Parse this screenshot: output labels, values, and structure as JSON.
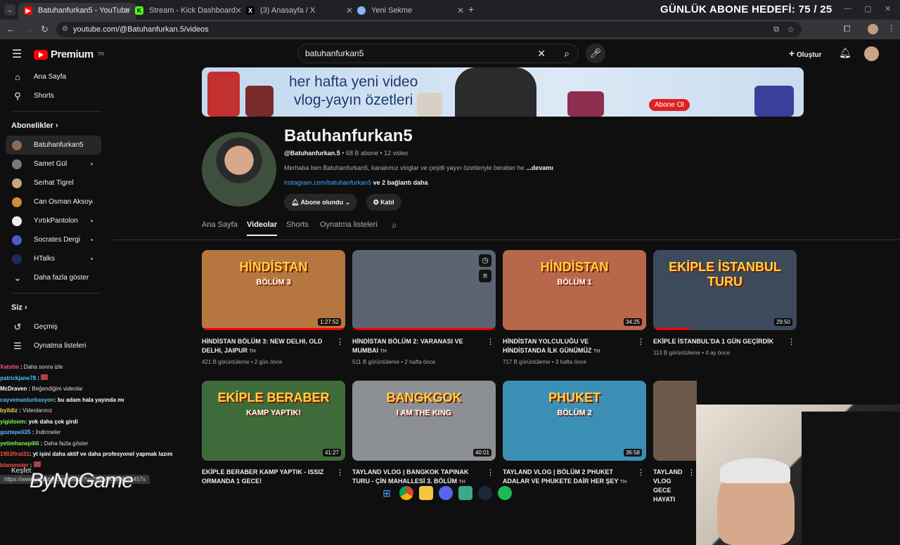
{
  "browser": {
    "tabs": [
      {
        "title": "Batuhanfurkan5 - YouTube",
        "favicon": "youtube-icon",
        "color": "#ff0000"
      },
      {
        "title": "Stream - Kick Dashboard",
        "favicon": "kick-icon",
        "color": "#53fc18"
      },
      {
        "title": "(3) Anasayfa / X",
        "favicon": "x-icon",
        "color": "#ffffff"
      },
      {
        "title": "Yeni Sekme",
        "favicon": "chrome-icon",
        "color": "#8ab4f8"
      }
    ],
    "url": "youtube.com/@Batuhanfurkan.5/videos",
    "status_url": "https://www.youtube.com/watch?v=25srtAXlSl8&t=1457s"
  },
  "overlay": {
    "goal": "GÜNLÜK ABONE HEDEFİ: 75 / 25",
    "watermark": "ByNoGame"
  },
  "youtube": {
    "logo_text": "Premium",
    "logo_region": "TR",
    "search_value": "batuhanfurkan5",
    "create_label": "Oluştur"
  },
  "sidebar": {
    "main": [
      {
        "label": "Ana Sayfa",
        "icon": "home-icon"
      },
      {
        "label": "Shorts",
        "icon": "shorts-icon"
      }
    ],
    "subs_title": "Abonelikler",
    "subs": [
      {
        "label": "Batuhanfurkan5",
        "dot": false
      },
      {
        "label": "Samet Gül",
        "dot": true
      },
      {
        "label": "Serhat Tigrel",
        "dot": false
      },
      {
        "label": "Can Osman Aksoy",
        "dot": true
      },
      {
        "label": "YırtıkPantolon",
        "dot": true
      },
      {
        "label": "Socrates Dergi",
        "dot": true
      },
      {
        "label": "HTalks",
        "dot": true
      }
    ],
    "show_more": "Daha fazla göster",
    "you_title": "Siz",
    "you": [
      {
        "label": "Geçmiş",
        "icon": "history-icon"
      },
      {
        "label": "Oynatma listeleri",
        "icon": "playlist-icon"
      },
      {
        "label": "Daha sonra izle",
        "icon": "clock-icon"
      },
      {
        "label": "Beğendiğim videolar",
        "icon": "like-icon"
      },
      {
        "label": "Videolarınız",
        "icon": "video-icon"
      },
      {
        "label": "İndirmeler",
        "icon": "download-icon"
      },
      {
        "label": "Daha fazla göster",
        "icon": "chevron-down-icon"
      },
      {
        "label": "Keşfet",
        "icon": "explore-icon"
      }
    ]
  },
  "banner": {
    "line1": "her hafta yeni video",
    "line2": "vlog-yayın özetleri",
    "subscribe": "Abone Ol"
  },
  "channel": {
    "name": "Batuhanfurkan5",
    "handle": "@Batuhanfurkan.5",
    "meta": " • 68 B abone • 12 video",
    "description": "Merhaba ben Batuhanfurkan5,  kanalımız vloglar ve çeşitli yayın özetleriyle beraber he",
    "more": "...devamı",
    "link": "instagram.com/batuhanfurkan5",
    "link_more": " ve 2 bağlantı daha",
    "subscribed_label": "Abone olundu",
    "join_label": "Katıl",
    "tabs": [
      "Ana Sayfa",
      "Videolar",
      "Shorts",
      "Oynatma listeleri"
    ]
  },
  "videos": [
    {
      "title": "HİNDİSTAN BÖLÜM 3: NEW DELHI, OLD DELHI, JAIPUR",
      "tag": "TH",
      "views": "421 B görüntüleme",
      "age": "2 gün önce",
      "duration": "1:27:52",
      "thumb_text": "HİNDİSTAN",
      "thumb_sub": "BÖLÜM 3",
      "thumb_bg": "#b5763f",
      "progress": 1.0
    },
    {
      "title": "HİNDİSTAN BÖLÜM 2: VARANASI VE MUMBAI",
      "tag": "TH",
      "views": "511 B görüntüleme",
      "age": "2 hafta önce",
      "duration": "",
      "thumb_text": "",
      "thumb_sub": "",
      "thumb_bg": "#5b6470",
      "progress": 1.0
    },
    {
      "title": "HİNDİSTAN YOLCULUĞU VE HİNDİSTANDA İLK GÜNÜMÜZ",
      "tag": "TH",
      "views": "717 B görüntüleme",
      "age": "3 hafta önce",
      "duration": "34:25",
      "thumb_text": "HİNDİSTAN",
      "thumb_sub": "BÖLÜM 1",
      "thumb_bg": "#b9674a",
      "progress": 0.0
    },
    {
      "title": "EKİPLE İSTANBUL'DA 1 GÜN GEÇİRDİK",
      "tag": "",
      "views": "113 B görüntüleme",
      "age": "4 ay önce",
      "duration": "29:50",
      "thumb_text": "EKİPLE İSTANBUL TURU",
      "thumb_sub": "",
      "thumb_bg": "#3d4a5c",
      "progress": 0.25
    },
    {
      "title": "EKİPLE BERABER KAMP YAPTIK - ISSIZ ORMANDA 1 GECE!",
      "tag": "",
      "views": "",
      "age": "",
      "duration": "41:27",
      "thumb_text": "EKİPLE BERABER",
      "thumb_sub": "KAMP YAPTIK!",
      "thumb_bg": "#3f6b3a",
      "progress": 0.0
    },
    {
      "title": "TAYLAND VLOG | BANGKOK TAPINAK TURU - ÇİN MAHALLESİ 3. BÖLÜM",
      "tag": "TH",
      "views": "",
      "age": "",
      "duration": "40:01",
      "thumb_text": "BANGKGOK",
      "thumb_sub": "I AM THE KING",
      "thumb_bg": "#8c8f93",
      "progress": 0.0
    },
    {
      "title": "TAYLAND VLOG | BÖLÜM 2 PHUKET ADALAR VE PHUKETE DAİR HER ŞEY",
      "tag": "TH",
      "views": "",
      "age": "",
      "duration": "36:58",
      "thumb_text": "PHUKET",
      "thumb_sub": "BÖLÜM 2",
      "thumb_bg": "#3b8fb5",
      "progress": 0.0
    },
    {
      "title": "TAYLAND VLOG GECE HAYATI",
      "tag": "",
      "views": "",
      "age": "",
      "duration": "",
      "thumb_text": "",
      "thumb_sub": "",
      "thumb_bg": "#6d5a4c",
      "progress": 0.0
    }
  ],
  "chat": [
    {
      "user": "Xatstm",
      "msg": "",
      "color": "#ff4fa3"
    },
    {
      "user": "patrickjane78",
      "msg": "",
      "color": "#4fc3ff"
    },
    {
      "user": "McDraven",
      "msg": "",
      "color": "#ffffff"
    },
    {
      "user": "cayvemasturbasyon",
      "msg": ": bu adam hala yayında mı",
      "color": "#4fc3ff"
    },
    {
      "user": "byildiz",
      "msg": "",
      "color": "#ffd54f"
    },
    {
      "user": "yigidoom",
      "msg": ": yok daha çok girdi",
      "color": "#7cff4f"
    },
    {
      "user": "goztepeli35",
      "msg": "",
      "color": "#4fc3ff"
    },
    {
      "user": "yetimhanepilili",
      "msg": "",
      "color": "#7cff4f"
    },
    {
      "user": "1903firat31",
      "msg": ": yt işini daha aktif ve daha profesyonel yapmak lazım",
      "color": "#ff4f4f"
    },
    {
      "user": "blammster",
      "msg": "",
      "color": "#ff4f4f"
    }
  ]
}
